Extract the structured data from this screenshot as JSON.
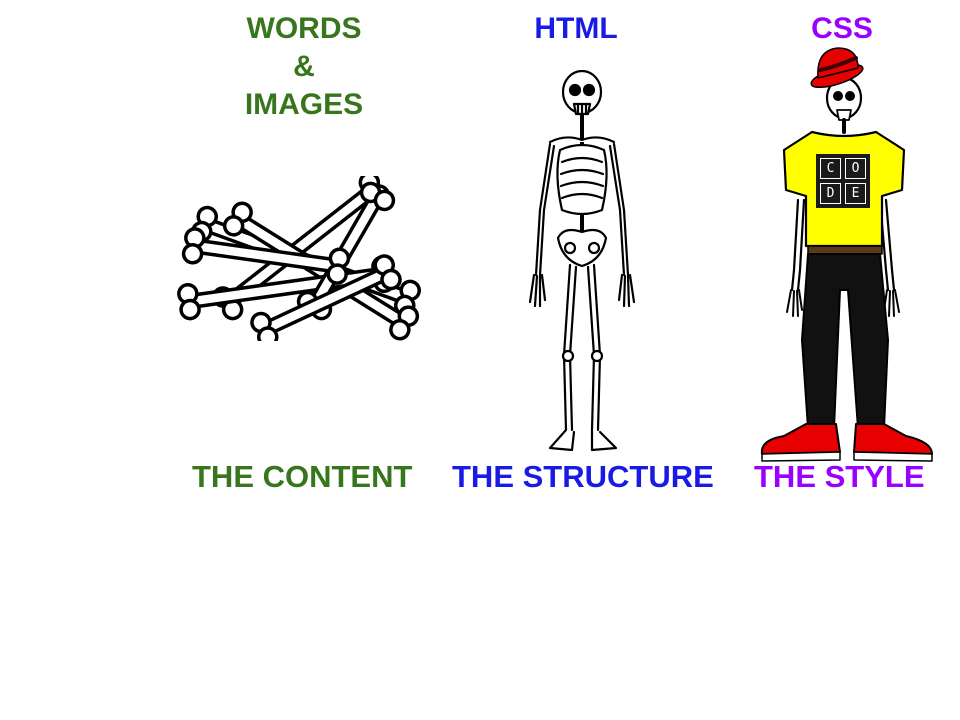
{
  "columns": [
    {
      "heading_lines": [
        "WORDS",
        "&",
        "IMAGES"
      ],
      "caption": "THE CONTENT",
      "color": "#38761d",
      "illustration": "bone-pile"
    },
    {
      "heading_lines": [
        "HTML"
      ],
      "caption": "THE STRUCTURE",
      "color": "#1a1ae6",
      "illustration": "skeleton"
    },
    {
      "heading_lines": [
        "CSS"
      ],
      "caption": "THE STYLE",
      "color": "#9900ff",
      "illustration": "dressed-skeleton"
    }
  ],
  "shirt_logo": [
    "C",
    "O",
    "D",
    "E"
  ]
}
